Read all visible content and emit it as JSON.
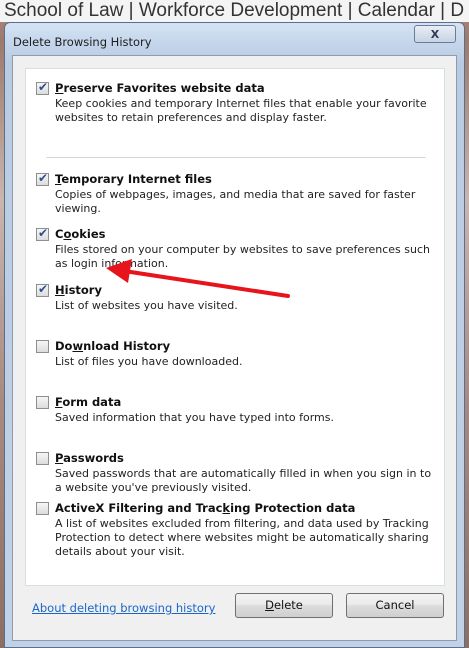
{
  "background_page": {
    "nav_text": "School of Law | Workforce Development | Calendar | D"
  },
  "dialog": {
    "title": "Delete Browsing History",
    "close_label": "X"
  },
  "options": [
    {
      "pre": "",
      "accel": "P",
      "post": "reserve Favorites website data",
      "checked": true,
      "description": "Keep cookies and temporary Internet files that enable your favorite websites to retain preferences and display faster."
    },
    {
      "pre": "",
      "accel": "T",
      "post": "emporary Internet files",
      "checked": true,
      "description": "Copies of webpages, images, and media that are saved for faster viewing."
    },
    {
      "pre": "C",
      "accel": "o",
      "post": "okies",
      "checked": true,
      "description": "Files stored on your computer by websites to save preferences such as login information."
    },
    {
      "pre": "",
      "accel": "H",
      "post": "istory",
      "checked": true,
      "description": "List of websites you have visited."
    },
    {
      "pre": "Do",
      "accel": "w",
      "post": "nload History",
      "checked": false,
      "description": "List of files you have downloaded."
    },
    {
      "pre": "",
      "accel": "F",
      "post": "orm data",
      "checked": false,
      "description": "Saved information that you have typed into forms."
    },
    {
      "pre": "",
      "accel": "P",
      "post": "asswords",
      "checked": false,
      "description": "Saved passwords that are automatically filled in when you sign in to a website you've previously visited."
    },
    {
      "pre": "ActiveX Filtering and Trac",
      "accel": "k",
      "post": "ing Protection data",
      "checked": false,
      "description": "A list of websites excluded from filtering, and data used by Tracking Protection to detect where websites might be automatically sharing details about your visit."
    }
  ],
  "footer": {
    "about_link": "About deleting browsing history",
    "delete_accel": "D",
    "delete_rest": "elete",
    "cancel_label": "Cancel"
  },
  "colors": {
    "link": "#1b66c9",
    "annotation_arrow": "#e8141b",
    "checkmark": "#2e4f87"
  }
}
